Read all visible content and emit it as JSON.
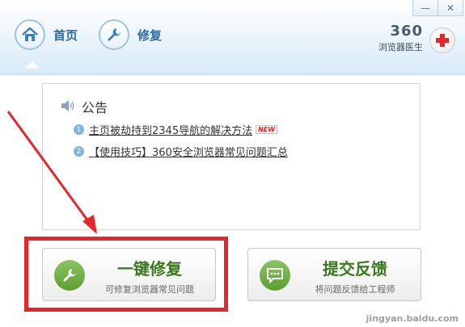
{
  "window": {
    "minimize_label": "—",
    "close_label": "✕"
  },
  "nav": {
    "home_label": "首页",
    "repair_label": "修复"
  },
  "brand": {
    "number": "360",
    "subtitle": "浏览器医生"
  },
  "notice": {
    "title": "公告",
    "items": [
      {
        "index": "1",
        "text": "主页被劫持到2345导航的解决方法",
        "badge": "NEW"
      },
      {
        "index": "2",
        "text": "【使用技巧】360安全浏览器常见问题汇总"
      }
    ]
  },
  "actions": {
    "repair": {
      "title": "一键修复",
      "subtitle": "可修复浏览器常见问题"
    },
    "feedback": {
      "title": "提交反馈",
      "subtitle": "将问题反馈给工程师"
    }
  },
  "watermark": "jingyan.baidu.com",
  "colors": {
    "accent_blue": "#2f6aa1",
    "action_green": "#3a7a1d",
    "highlight_red": "#e8262a"
  },
  "icons": {
    "home": "home-icon",
    "repair": "wrench-icon",
    "notice": "speaker-icon",
    "brand": "medical-cross-icon",
    "feedback": "chat-bubble-icon"
  }
}
